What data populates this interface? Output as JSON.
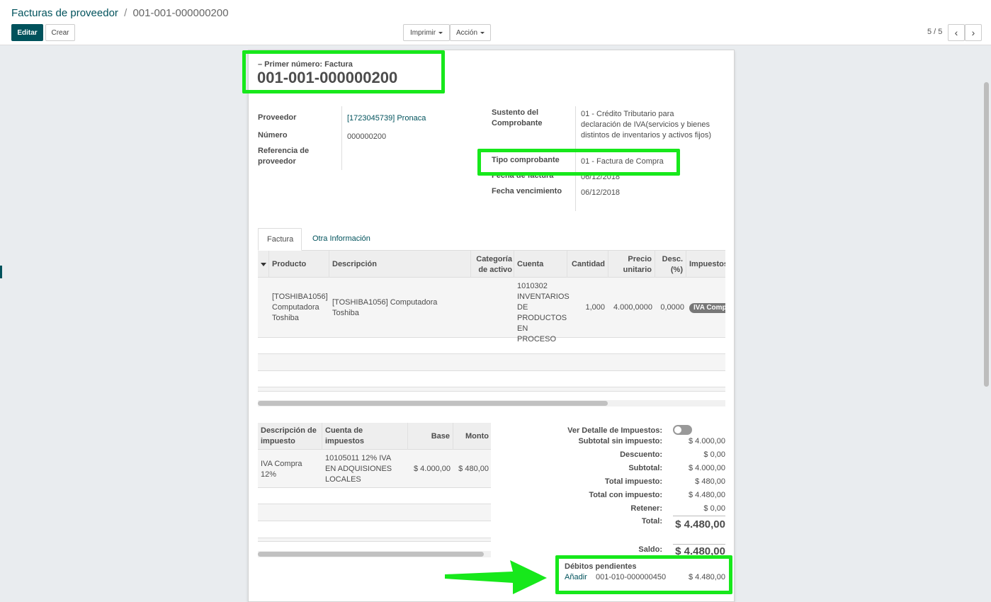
{
  "breadcrumb": {
    "parent": "Facturas de proveedor",
    "separator": "/",
    "current": "001-001-000000200"
  },
  "toolbar": {
    "edit": "Editar",
    "create": "Crear",
    "print": "Imprimir",
    "action": "Acción"
  },
  "pager": {
    "value": "5 / 5",
    "prev": "‹",
    "next": "›"
  },
  "header": {
    "subtitle": "– Primer número: Factura",
    "number": "001-001-000000200"
  },
  "fields_left": [
    {
      "label": "Proveedor",
      "value": "[1723045739] Pronaca"
    },
    {
      "label": "Número",
      "value": "000000200"
    },
    {
      "label": "Referencia de proveedor",
      "value": ""
    }
  ],
  "fields_right": [
    {
      "label": "Sustento del Comprobante",
      "value": "01 - Crédito Tributario para declaración de IVA(servicios y bienes distintos de inventarios y activos fijos)"
    },
    {
      "label": "Tipo comprobante",
      "value": "01 - Factura de Compra"
    },
    {
      "label": "Fecha de factura",
      "value": "06/12/2018"
    },
    {
      "label": "Fecha vencimiento",
      "value": "06/12/2018"
    }
  ],
  "tabs": [
    {
      "label": "Factura"
    },
    {
      "label": "Otra Información"
    }
  ],
  "lines_table": {
    "headers": [
      "Producto",
      "Descripción",
      "Categoría de activo",
      "Cuenta",
      "Cantidad",
      "Precio unitario",
      "Desc. (%)",
      "Impuestos"
    ],
    "rows": [
      {
        "producto": "[TOSHIBA1056] Computadora Toshiba",
        "descripcion": "[TOSHIBA1056] Computadora Toshiba",
        "categoria": "",
        "cuenta": "1010302 INVENTARIOS DE PRODUCTOS EN PROCESO",
        "cantidad": "1,000",
        "precio": "4.000,0000",
        "desc": "0,0000",
        "impuestos": "IVA Compra"
      }
    ]
  },
  "tax_table": {
    "headers": [
      "Descripción de impuesto",
      "Cuenta de impuestos",
      "Base",
      "Monto"
    ],
    "rows": [
      {
        "descripcion": "IVA Compra 12%",
        "cuenta": "10105011 12% IVA EN ADQUISIONES LOCALES",
        "base": "$ 4.000,00",
        "monto": "$ 480,00"
      }
    ]
  },
  "totals": {
    "detail_label": "Ver Detalle de Impuestos:",
    "items": [
      {
        "label": "Subtotal sin impuesto:",
        "value": "$ 4.000,00"
      },
      {
        "label": "Descuento:",
        "value": "$ 0,00"
      },
      {
        "label": "Subtotal:",
        "value": "$ 4.000,00"
      },
      {
        "label": "Total impuesto:",
        "value": "$ 480,00"
      },
      {
        "label": "Total con impuesto:",
        "value": "$ 4.480,00"
      },
      {
        "label": "Retener:",
        "value": "$ 0,00"
      }
    ],
    "total_label": "Total:",
    "total_value": "$ 4.480,00",
    "saldo_label": "Saldo:",
    "saldo_value": "$ 4.480,00"
  },
  "pending": {
    "title": "Débitos pendientes",
    "add": "Añadir",
    "doc": "001-010-000000450",
    "amount": "$ 4.480,00"
  },
  "colors": {
    "primary": "#00525c",
    "highlight": "#17e81b",
    "badge": "#777777"
  }
}
